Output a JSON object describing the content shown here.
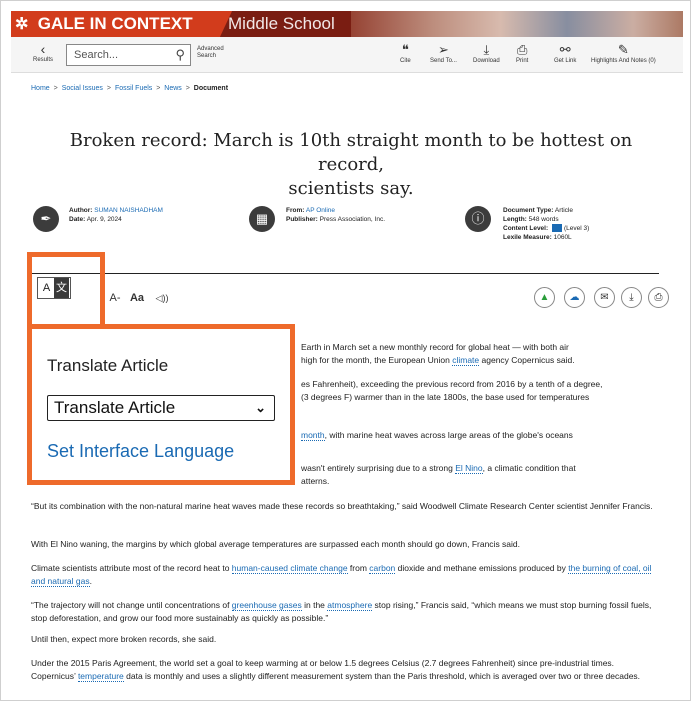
{
  "banner": {
    "brand": "GALE IN CONTEXT",
    "edition": "Middle School"
  },
  "toolbar": {
    "results_label": "Results",
    "search_placeholder": "Search...",
    "advanced_label_1": "Advanced",
    "advanced_label_2": "Search",
    "cite_label": "Cite",
    "send_to_label": "Send To...",
    "download_label": "Download",
    "print_label": "Print",
    "get_link_label": "Get Link",
    "highlights_label": "Highlights And Notes (0)"
  },
  "breadcrumb": {
    "items": [
      "Home",
      "Social Issues",
      "Fossil Fuels",
      "News"
    ],
    "current": "Document",
    "separator": ">"
  },
  "article": {
    "title_line1": "Broken record: March is 10th straight month to be hottest on record,",
    "title_line2": "scientists say.",
    "author_label": "Author:",
    "author": "SUMAN NAISHADHAM",
    "date_label": "Date:",
    "date": "Apr. 9, 2024",
    "from_label": "From:",
    "from": "AP Online",
    "publisher_label": "Publisher:",
    "publisher": "Press Association, Inc.",
    "doc_type_label": "Document Type:",
    "doc_type": "Article",
    "length_label": "Length:",
    "length": "548 words",
    "content_level_label": "Content Level:",
    "content_level": "(Level 3)",
    "lexile_label": "Lexile Measure:",
    "lexile": "1060L"
  },
  "tools": {
    "translate_glyph_1": "A",
    "translate_glyph_2": "文",
    "font_decrease": "A-",
    "font_style": "Aa",
    "listen": "◁))"
  },
  "popup": {
    "title": "Translate Article",
    "select_value": "Translate Article",
    "set_language": "Set Interface Language"
  },
  "body": {
    "p1a_text": "Earth in March set a new monthly record for global heat — with both air",
    "p1b_pre": "high for the month, the European Union ",
    "p1b_link": "climate",
    "p1b_post": " agency Copernicus said.",
    "p2a_text": "es Fahrenheit), exceeding the previous record from 2016 by a tenth of a degree,",
    "p2b_text": "(3 degrees F) warmer than in the late 1800s, the base used for temperatures",
    "p3_link": "month",
    "p3_post": ", with marine heat waves across large areas of the globe's oceans",
    "p4a_pre": "wasn't entirely surprising due to a strong ",
    "p4a_link": "El Nino",
    "p4a_post": ", a climatic condition that",
    "p4b_text": "atterns.",
    "p5_text": "“But its combination with the non-natural marine heat waves made these records so breathtaking,” said Woodwell Climate Research Center scientist Jennifer Francis.",
    "p6_text": "With El Nino waning, the margins by which global average temperatures are surpassed each month should go down, Francis said.",
    "p7_pre": "Climate scientists attribute most of the record heat to ",
    "p7_link1": "human-caused climate change",
    "p7_mid": " from ",
    "p7_link2": "carbon",
    "p7_mid2": " dioxide and methane emissions produced by ",
    "p7_link3": "the burning of coal, oil and natural gas",
    "p7_post": ".",
    "p8_pre": "“The trajectory will not change until concentrations of ",
    "p8_link1": "greenhouse gases",
    "p8_mid": " in the ",
    "p8_link2": "atmosphere",
    "p8_post": " stop rising,” Francis said, “which means we must stop burning fossil fuels, stop deforestation, and grow our food more sustainably as quickly as possible.”",
    "p9_text": "Until then, expect more broken records, she said.",
    "p10_pre": "Under the 2015 Paris Agreement, the world set a goal to keep warming at or below 1.5 degrees Celsius (2.7 degrees Fahrenheit) since pre-industrial times. Copernicus’ ",
    "p10_link": "temperature",
    "p10_post": " data is monthly and uses a slightly different measurement system than the Paris threshold, which is averaged over two or three decades."
  }
}
